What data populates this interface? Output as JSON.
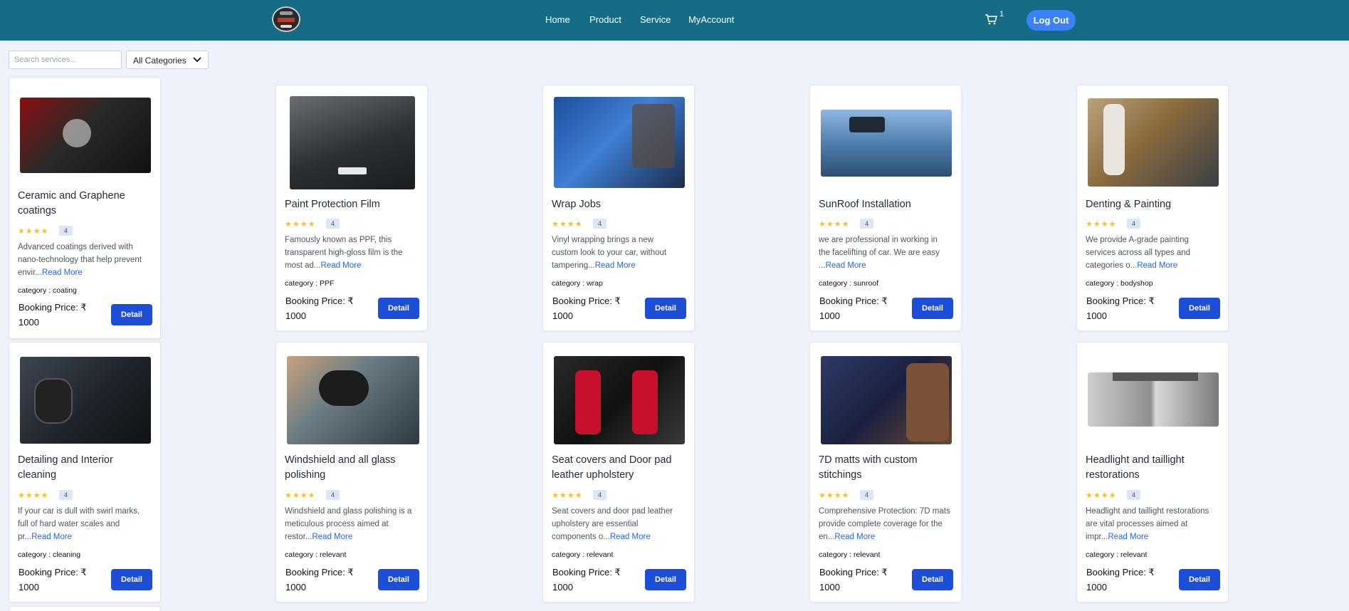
{
  "nav": {
    "home": "Home",
    "product": "Product",
    "service": "Service",
    "account": "MyAccount",
    "cart_count": "1",
    "logout": "Log Out"
  },
  "filters": {
    "search_placeholder": "Search services...",
    "category_selected": "All Categories"
  },
  "cards": [
    {
      "title_l1": "Ceramic and Graphene",
      "title_l2": "coatings",
      "rating": "4",
      "stars": "★★★★",
      "desc_l1": "Advanced coatings derived with",
      "desc_l2": "nano-technology that help prevent",
      "desc_l3": "envir...",
      "read_more": "Read More",
      "category": "category : coating",
      "price_l1": "Booking Price: ₹",
      "price_l2": "1000",
      "detail": "Detail"
    },
    {
      "title_l1": "Paint Protection Film",
      "title_l2": "",
      "rating": "4",
      "stars": "★★★★",
      "desc_l1": "Famously known as PPF, this",
      "desc_l2": "transparent high-gloss film is the",
      "desc_l3": "most ad...",
      "read_more": "Read More",
      "category": "category : PPF",
      "price_l1": "Booking Price: ₹",
      "price_l2": "1000",
      "detail": "Detail"
    },
    {
      "title_l1": "Wrap Jobs",
      "title_l2": "",
      "rating": "4",
      "stars": "★★★★",
      "desc_l1": "Vinyl wrapping brings a new",
      "desc_l2": "custom look to your car, without",
      "desc_l3": "tampering...",
      "read_more": "Read More",
      "category": "category : wrap",
      "price_l1": "Booking Price: ₹",
      "price_l2": "1000",
      "detail": "Detail"
    },
    {
      "title_l1": "SunRoof Installation",
      "title_l2": "",
      "rating": "4",
      "stars": "★★★★",
      "desc_l1": "we are professional in working in",
      "desc_l2": "the facelifting of car. We are easy",
      "desc_l3": "...",
      "read_more": "Read More",
      "category": "category : sunroof",
      "price_l1": "Booking Price: ₹",
      "price_l2": "1000",
      "detail": "Detail"
    },
    {
      "title_l1": "Denting & Painting",
      "title_l2": "",
      "rating": "4",
      "stars": "★★★★",
      "desc_l1": "We provide A-grade painting",
      "desc_l2": "services across all types and",
      "desc_l3": "categories o...",
      "read_more": "Read More",
      "category": "category : bodyshop",
      "price_l1": "Booking Price: ₹",
      "price_l2": "1000",
      "detail": "Detail"
    },
    {
      "title_l1": "Detailing and Interior",
      "title_l2": "cleaning",
      "rating": "4",
      "stars": "★★★★",
      "desc_l1": "If your car is dull with swirl marks,",
      "desc_l2": "full of hard water scales and",
      "desc_l3": "pr...",
      "read_more": "Read More",
      "category": "category : cleaning",
      "price_l1": "Booking Price: ₹",
      "price_l2": "1000",
      "detail": "Detail"
    },
    {
      "title_l1": "Windshield and all glass",
      "title_l2": "polishing",
      "rating": "4",
      "stars": "★★★★",
      "desc_l1": "Windshield and glass polishing is a",
      "desc_l2": "meticulous process aimed at",
      "desc_l3": "restor...",
      "read_more": "Read More",
      "category": "category : relevant",
      "price_l1": "Booking Price: ₹",
      "price_l2": "1000",
      "detail": "Detail"
    },
    {
      "title_l1": "Seat covers and Door pad",
      "title_l2": "leather upholstery",
      "rating": "4",
      "stars": "★★★★",
      "desc_l1": "Seat covers and door pad leather",
      "desc_l2": "upholstery are essential",
      "desc_l3": "components o...",
      "read_more": "Read More",
      "category": "category : relevant",
      "price_l1": "Booking Price: ₹",
      "price_l2": "1000",
      "detail": "Detail"
    },
    {
      "title_l1": "7D matts with custom",
      "title_l2": "stitchings",
      "rating": "4",
      "stars": "★★★★",
      "desc_l1": "Comprehensive Protection: 7D mats",
      "desc_l2": "provide complete coverage for the",
      "desc_l3": "en...",
      "read_more": "Read More",
      "category": "category : relevant",
      "price_l1": "Booking Price: ₹",
      "price_l2": "1000",
      "detail": "Detail"
    },
    {
      "title_l1": "Headlight and taillight",
      "title_l2": "restorations",
      "rating": "4",
      "stars": "★★★★",
      "desc_l1": "Headlight and taillight restorations",
      "desc_l2": "are vital processes aimed at",
      "desc_l3": "impr...",
      "read_more": "Read More",
      "category": "category : relevant",
      "price_l1": "Booking Price: ₹",
      "price_l2": "1000",
      "detail": "Detail"
    }
  ]
}
